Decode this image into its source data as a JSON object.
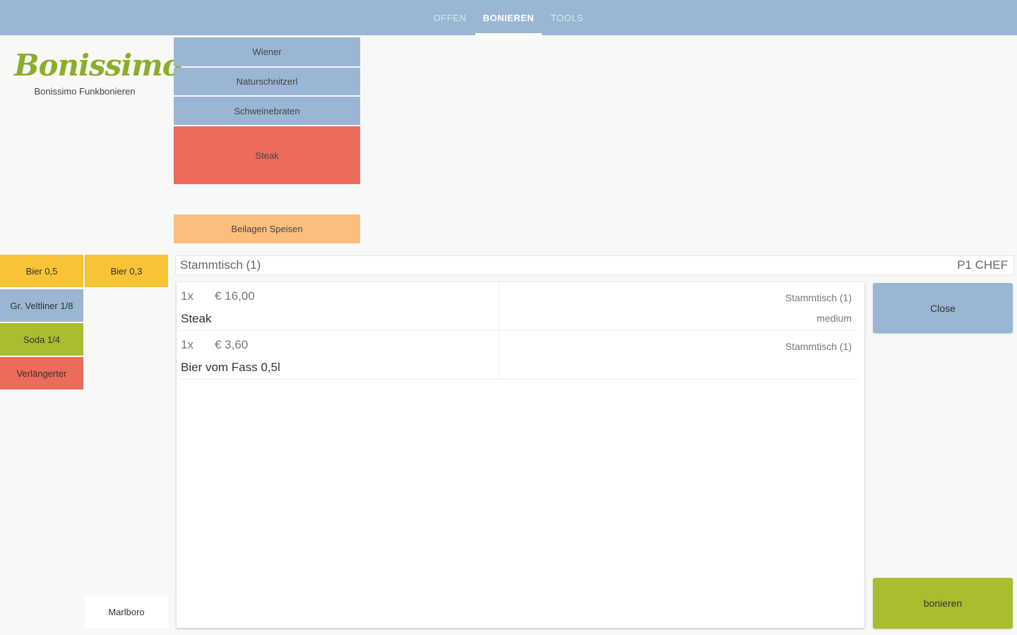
{
  "nav": {
    "tabs": [
      {
        "label": "OFFEN",
        "active": false
      },
      {
        "label": "BONIEREN",
        "active": true
      },
      {
        "label": "TOOLS",
        "active": false
      }
    ]
  },
  "logo": {
    "wordmark": "Bonissimo",
    "subtitle": "Bonissimo Funkbonieren"
  },
  "menu": {
    "items": [
      {
        "label": "Wiener",
        "color": "#9ab6d4"
      },
      {
        "label": "Naturschnitzerl",
        "color": "#9ab6d4"
      },
      {
        "label": "Schweinebraten",
        "color": "#9ab6d4"
      },
      {
        "label": "Steak",
        "color": "#ec6b5a"
      }
    ],
    "beilagen": {
      "label": "Beilagen Speisen",
      "color": "#fdbe7d"
    }
  },
  "quick": {
    "items": [
      {
        "label": "Bier 0,5",
        "color": "#f8c336"
      },
      {
        "label": "Bier 0,3",
        "color": "#f8c336"
      },
      {
        "label": "Gr. Veltliner 1/8",
        "color": "#9ab6d4"
      },
      {
        "label": "Soda 1/4",
        "color": "#aabd2e"
      },
      {
        "label": "Verlängerter",
        "color": "#ec6b5a"
      },
      {
        "label": "Marlboro",
        "color": "#ffffff"
      }
    ]
  },
  "table_bar": {
    "table_name": "Stammtisch (1)",
    "waiter": "P1 CHEF"
  },
  "order": {
    "items": [
      {
        "qty": "1x",
        "price": "€ 16,00",
        "name": "Steak",
        "table": "Stammtisch (1)",
        "note": "medium"
      },
      {
        "qty": "1x",
        "price": "€ 3,60",
        "name": "Bier vom Fass 0,5l",
        "table": "Stammtisch (1)",
        "note": ""
      }
    ]
  },
  "actions": {
    "close_label": "Close",
    "submit_label": "bonieren"
  },
  "colors": {
    "accent_blue": "#9ab6d4",
    "accent_green": "#aabd2e",
    "accent_red": "#ec6b5a",
    "accent_yellow": "#f8c336",
    "accent_orange": "#fdbe7d"
  }
}
